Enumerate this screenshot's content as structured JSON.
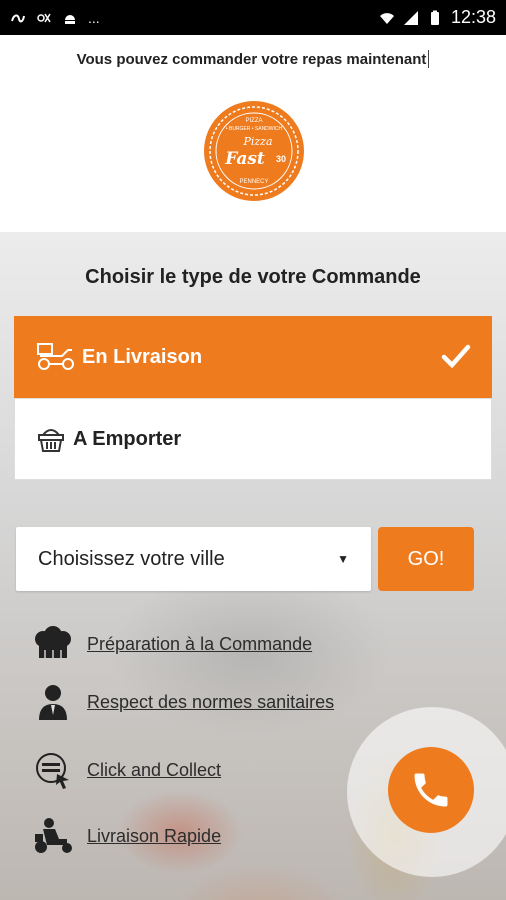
{
  "status_bar": {
    "time": "12:38",
    "left_icons": [
      "app-notification-icon",
      "wifi-calling-icon",
      "android-icon"
    ],
    "more": "...",
    "right_icons": [
      "wifi-icon",
      "signal-icon",
      "battery-icon"
    ]
  },
  "header": {
    "message": "Vous pouvez commander votre repas maintenant"
  },
  "logo": {
    "top_text": "PIZZA",
    "sub_text": "• BURGER • SANDWICH",
    "brand_script": "Pizza",
    "brand_main": "Fast",
    "number": "30",
    "bottom_text": "PENNECY"
  },
  "order_type": {
    "title": "Choisir le type de votre Commande",
    "options": [
      {
        "label": "En Livraison",
        "icon": "delivery-scooter-icon",
        "selected": true
      },
      {
        "label": "A Emporter",
        "icon": "basket-icon",
        "selected": false
      }
    ]
  },
  "city": {
    "placeholder": "Choisissez votre ville",
    "go_label": "GO!"
  },
  "features": [
    {
      "label": "Préparation à la Commande",
      "icon": "chef-hat-icon"
    },
    {
      "label": "Respect des normes sanitaires",
      "icon": "person-icon"
    },
    {
      "label": "Click and Collect",
      "icon": "click-collect-icon"
    },
    {
      "label": "Livraison Rapide",
      "icon": "scooter-icon"
    }
  ],
  "colors": {
    "accent": "#ef7b1f",
    "status_bar": "#000000"
  },
  "call_button": {
    "icon": "phone-icon"
  }
}
